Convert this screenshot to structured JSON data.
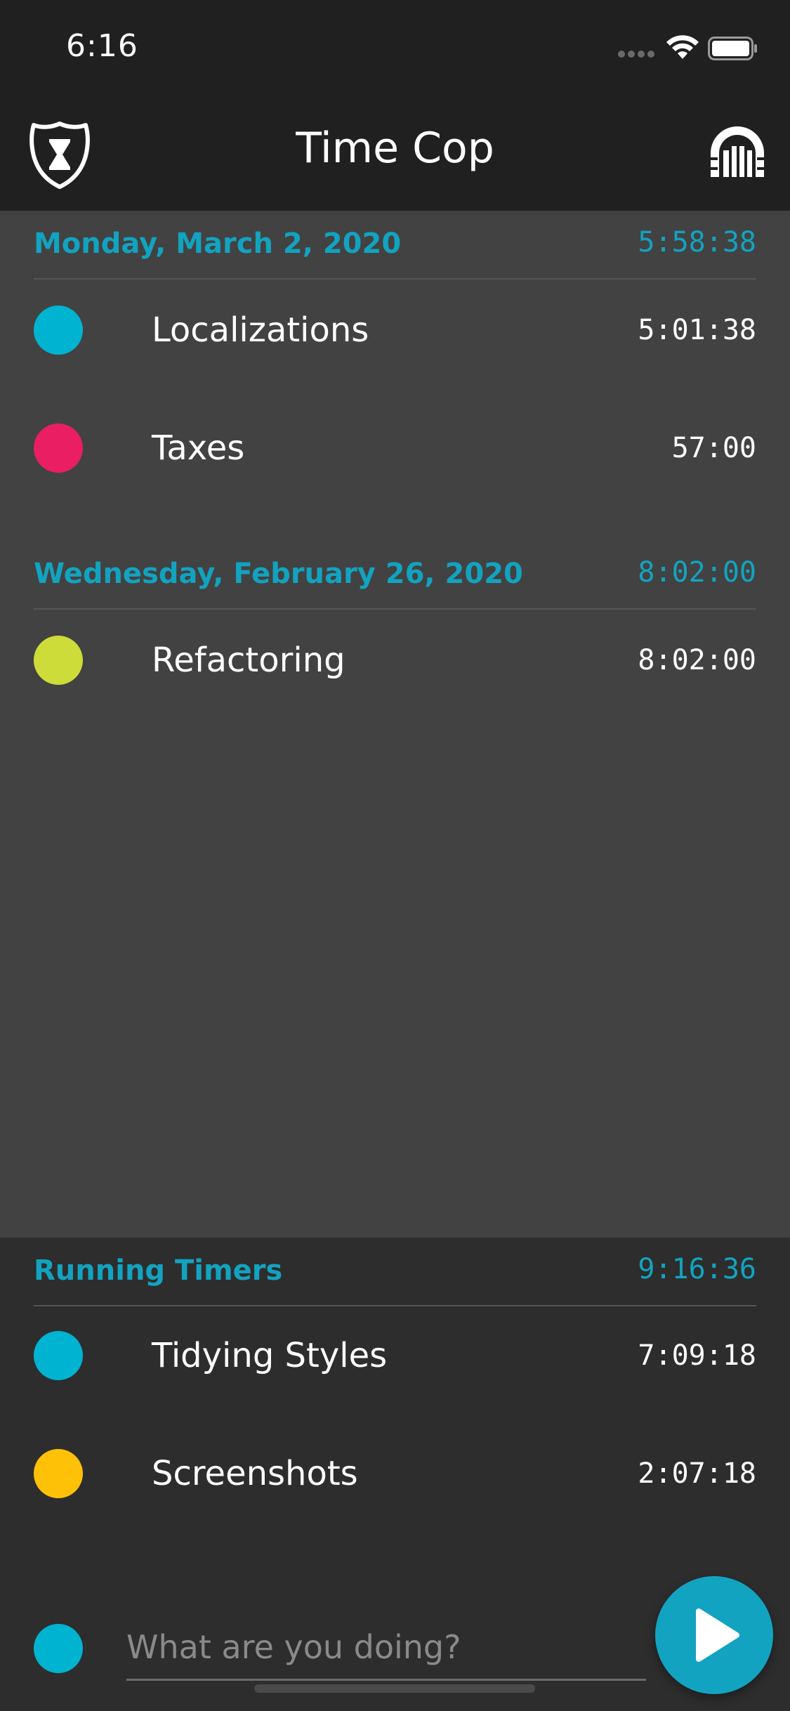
{
  "status_bar": {
    "time": "6:16",
    "signal_icon": "cellular-signal-icon",
    "wifi_icon": "wifi-icon",
    "battery_icon": "battery-icon"
  },
  "app_bar": {
    "title": "Time Cop",
    "left_icon": "police-badge-hourglass-icon",
    "right_icon": "export-archive-icon"
  },
  "history": {
    "days": [
      {
        "date": "Monday, March 2, 2020",
        "total": "5:58:38",
        "entries": [
          {
            "project": "Localizations",
            "duration": "5:01:38",
            "color": "#00b3d1"
          },
          {
            "project": "Taxes",
            "duration": "57:00",
            "color": "#e91e63"
          }
        ]
      },
      {
        "date": "Wednesday, February 26, 2020",
        "total": "8:02:00",
        "entries": [
          {
            "project": "Refactoring",
            "duration": "8:02:00",
            "color": "#cddc39"
          }
        ]
      }
    ]
  },
  "running": {
    "title": "Running Timers",
    "total": "9:16:36",
    "timers": [
      {
        "project": "Tidying Styles",
        "duration": "7:09:18",
        "color": "#00b3d1"
      },
      {
        "project": "Screenshots",
        "duration": "2:07:18",
        "color": "#ffc107"
      }
    ],
    "new_timer": {
      "placeholder": "What are you doing?",
      "value": "",
      "color": "#00b3d1"
    },
    "start_icon": "play-icon"
  },
  "colors": {
    "accent": "#12a3c0",
    "app_bar": "#202020",
    "history_bg": "#424242",
    "running_bg": "#2d2d2d"
  }
}
